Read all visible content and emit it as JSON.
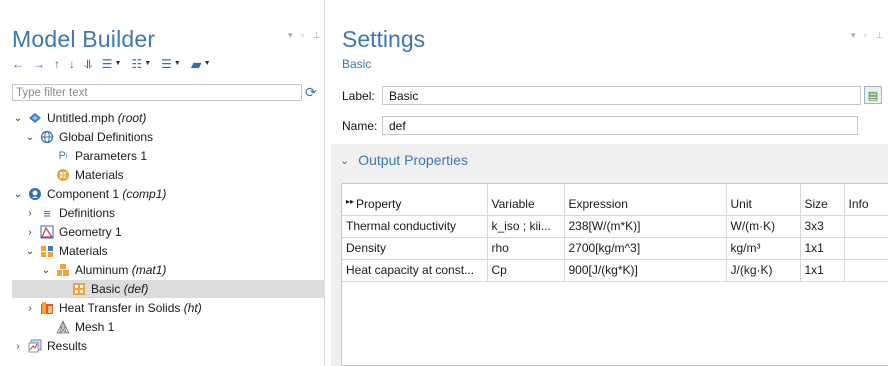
{
  "model_builder": {
    "title": "Model Builder",
    "pane_controls": "▾ ▫ ⊥",
    "filter_placeholder": "Type filter text",
    "tree": [
      {
        "label": "Untitled.mph",
        "suffix": "(root)",
        "icon": "root-icon",
        "indent": 0,
        "twisty": "open"
      },
      {
        "label": "Global Definitions",
        "suffix": "",
        "icon": "globe-icon",
        "indent": 1,
        "twisty": "open"
      },
      {
        "label": "Parameters 1",
        "suffix": "",
        "icon": "parameters-icon",
        "indent": 2,
        "twisty": "none"
      },
      {
        "label": "Materials",
        "suffix": "",
        "icon": "materials-icon",
        "indent": 2,
        "twisty": "none"
      },
      {
        "label": "Component 1",
        "suffix": "(comp1)",
        "icon": "component-icon",
        "indent": 1,
        "twisty": "open"
      },
      {
        "label": "Definitions",
        "suffix": "",
        "icon": "definitions-icon",
        "indent": 2,
        "twisty": "closed"
      },
      {
        "label": "Geometry 1",
        "suffix": "",
        "icon": "geometry-icon",
        "indent": 2,
        "twisty": "closed"
      },
      {
        "label": "Materials",
        "suffix": "",
        "icon": "materials-folder-icon",
        "indent": 2,
        "twisty": "open"
      },
      {
        "label": "Aluminum",
        "suffix": "(mat1)",
        "icon": "material-icon",
        "indent": 3,
        "twisty": "open"
      },
      {
        "label": "Basic",
        "suffix": "(def)",
        "icon": "basic-property-icon",
        "indent": 4,
        "twisty": "none",
        "selected": true
      },
      {
        "label": "Heat Transfer in Solids",
        "suffix": "(ht)",
        "icon": "heat-transfer-icon",
        "indent": 2,
        "twisty": "closed"
      },
      {
        "label": "Mesh 1",
        "suffix": "",
        "icon": "mesh-icon",
        "indent": 2,
        "twisty": "none"
      },
      {
        "label": "Results",
        "suffix": "",
        "icon": "results-icon",
        "indent": 1,
        "twisty": "closed"
      }
    ]
  },
  "settings": {
    "title": "Settings",
    "pane_controls": "▾ ▫ ⊥",
    "subtitle": "Basic",
    "label_field": {
      "label": "Label:",
      "value": "Basic"
    },
    "name_field": {
      "label": "Name:",
      "value": "def"
    },
    "section": {
      "title": "Output Properties"
    },
    "table": {
      "columns": [
        "Property",
        "Variable",
        "Expression",
        "Unit",
        "Size",
        "Info"
      ],
      "rows": [
        [
          "Thermal conductivity",
          "k_iso ; kii...",
          "238[W/(m*K)]",
          "W/(m·K)",
          "3x3",
          ""
        ],
        [
          "Density",
          "rho",
          "2700[kg/m^3]",
          "kg/m³",
          "1x1",
          ""
        ],
        [
          "Heat capacity at const...",
          "Cp",
          "900[J/(kg*K)]",
          "J/(kg·K)",
          "1x1",
          ""
        ]
      ]
    }
  },
  "colors": {
    "accent": "#3c78b4",
    "selection": "#dcdcdc",
    "section_bg": "#f0f0f0"
  }
}
